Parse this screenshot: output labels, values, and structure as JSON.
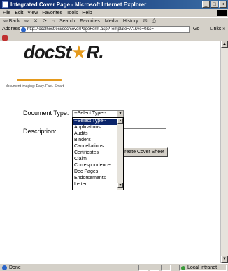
{
  "window": {
    "title": "Integrated Cover Page - Microsoft Internet Explorer",
    "minimize": "_",
    "maximize": "□",
    "close": "×"
  },
  "menu": [
    "File",
    "Edit",
    "View",
    "Favorites",
    "Tools",
    "Help"
  ],
  "toolbar": {
    "back": "⇦ Back",
    "forward": "⇨",
    "stop": "✕",
    "refresh": "⟳",
    "home": "⌂",
    "search": "Search",
    "favorites": "Favorites",
    "media": "Media",
    "history": "History",
    "mail": "✉",
    "print": "⎙"
  },
  "address": {
    "label": "Address",
    "url": "http://localhost/eci/sec/coverPageForm.asp?Template=A?&ve=0&s=",
    "go": "Go",
    "links": "Links »"
  },
  "logo": {
    "part1": "doc",
    "part2": "St",
    "star": "★",
    "part3": "R",
    "suffix": ".",
    "tagline": "document imaging:  Easy. Fast. Smart."
  },
  "form": {
    "document_type_label": "Document Type:",
    "select_value": "--Select Type--",
    "select_arrow": "▼",
    "description_label": "Description:",
    "create_button": "Create Cover Sheet"
  },
  "dropdown": {
    "options": [
      "--Select Type--",
      "Applications",
      "Audits",
      "Binders",
      "Cancellations",
      "Certificates",
      "Claim",
      "Correspondence",
      "Dec Pages",
      "Endorsements",
      "Letter"
    ],
    "selected_index": 0
  },
  "status": {
    "text": "Done",
    "zone": "Local intranet"
  },
  "colors": {
    "accent": "#e59a1c",
    "selection": "#0a246a",
    "titlebar": "#0a246a"
  }
}
